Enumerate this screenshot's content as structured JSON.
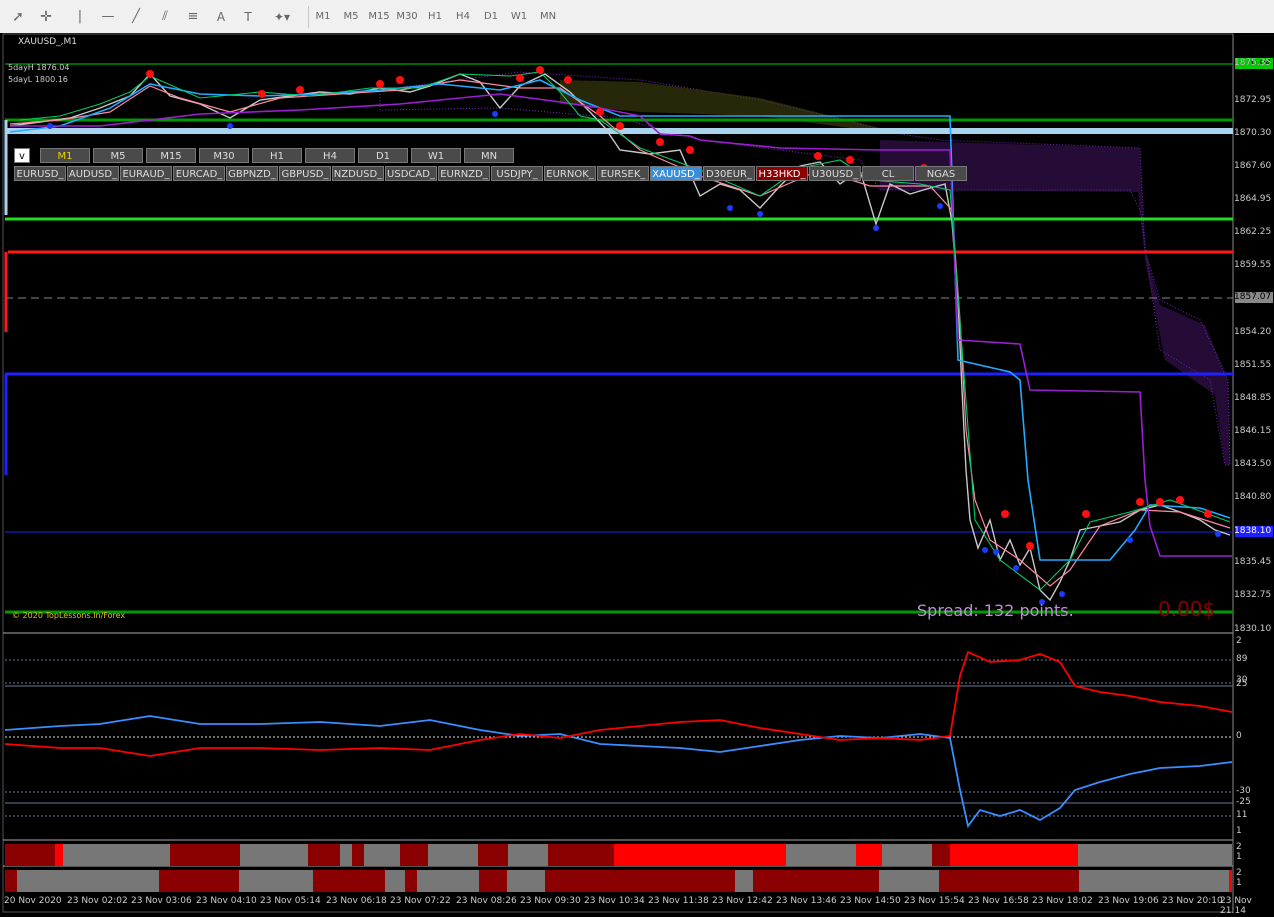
{
  "toolbar": {
    "timeframes": [
      "M1",
      "M5",
      "M15",
      "M30",
      "H1",
      "H4",
      "D1",
      "W1",
      "MN"
    ]
  },
  "chart": {
    "title": "XAUUSD_,M1",
    "day_high": "5dayH 1876.04",
    "day_low": "5dayL 1800.16",
    "copyright": "© 2020 TopLessons.In/Forex",
    "spread": "Spread: 132 points.",
    "profit": "0.00$",
    "toggle_label": "v",
    "tf_buttons": [
      "M1",
      "M5",
      "M15",
      "M30",
      "H1",
      "H4",
      "D1",
      "W1",
      "MN"
    ],
    "symbol_buttons": [
      "EURUSD_",
      "AUDUSD_",
      "EURAUD_",
      "EURCAD_",
      "GBPNZD_",
      "GBPUSD_",
      "NZDUSD_",
      "USDCAD_",
      "EURNZD_",
      "USDJPY_",
      "EURNOK_",
      "EURSEK_",
      "XAUUSD_",
      "D30EUR_",
      "H33HKD_",
      "U30USD_",
      "CL",
      "NGAS"
    ],
    "active_symbol": "XAUUSD_",
    "price_axis": [
      "1875.35",
      "1872.95",
      "1870.30",
      "1867.60",
      "1864.95",
      "1862.25",
      "1859.55",
      "1857.07",
      "1854.20",
      "1851.55",
      "1848.85",
      "1846.15",
      "1843.50",
      "1840.80",
      "1838.10",
      "1835.45",
      "1832.75",
      "1830.10"
    ],
    "price_marker_top": "1876.04",
    "price_marker_dashed": "1857.07",
    "price_marker_current": "1838.10",
    "osc_axis": [
      "2",
      "89",
      "30",
      "25",
      "0",
      "-30",
      "-25",
      "11",
      "1"
    ],
    "hist_axis_1": [
      "2",
      "1"
    ],
    "hist_axis_2": [
      "2",
      "1"
    ],
    "time_axis": [
      "20 Nov 2020",
      "23 Nov 02:02",
      "23 Nov 03:06",
      "23 Nov 04:10",
      "23 Nov 05:14",
      "23 Nov 06:18",
      "23 Nov 07:22",
      "23 Nov 08:26",
      "23 Nov 09:30",
      "23 Nov 10:34",
      "23 Nov 11:38",
      "23 Nov 12:42",
      "23 Nov 13:46",
      "23 Nov 14:50",
      "23 Nov 15:54",
      "23 Nov 16:58",
      "23 Nov 18:02",
      "23 Nov 19:06",
      "23 Nov 20:10",
      "23 Nov 21:14"
    ]
  },
  "colors": {
    "background": "#000000",
    "price_line": "#c8c8c8",
    "red_line": "#ff1a1a",
    "blue_line": "#1f1fff",
    "green_line": "#00cc00",
    "light_blue": "#aad4ee",
    "purple": "#9b1fd0",
    "osc_red": "#ff0000",
    "osc_blue": "#3a8eff",
    "active_symbol": "#3a8ed9",
    "alert_symbol": "#8b0000"
  }
}
